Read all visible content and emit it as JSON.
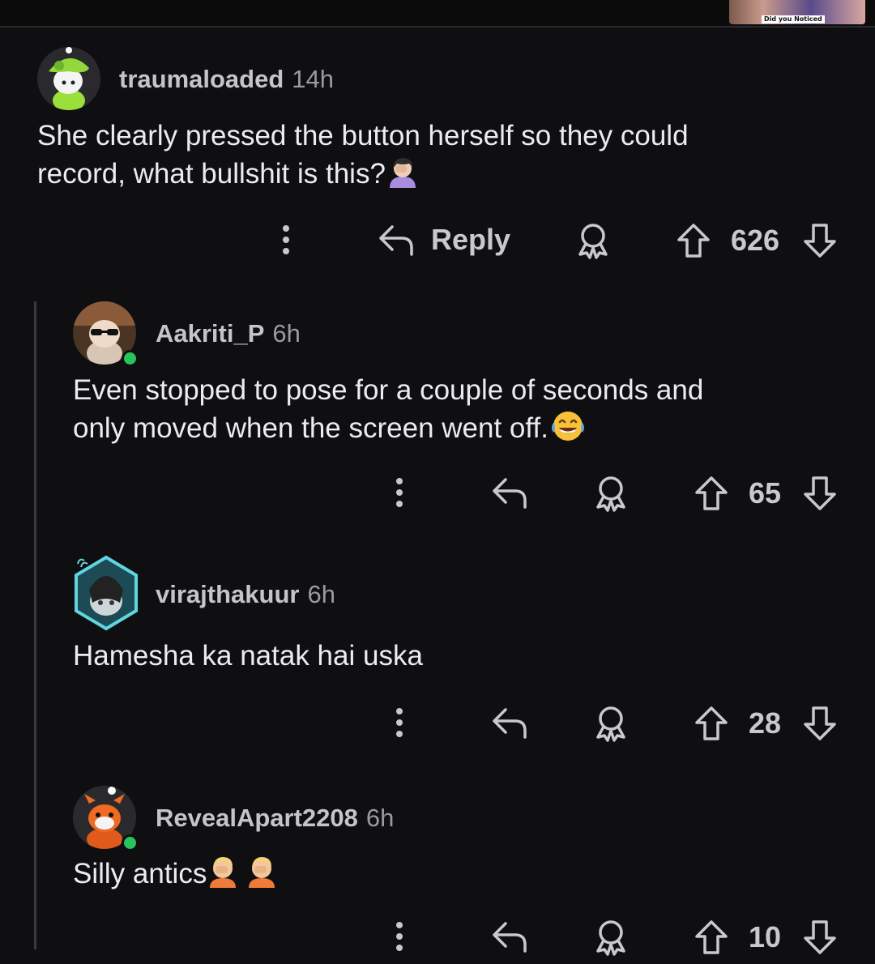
{
  "video_thumbnail": {
    "caption": "Did you Noticed"
  },
  "comments": [
    {
      "username": "traumaloaded",
      "age": "14h",
      "body": "She clearly pressed the button herself so they could",
      "body_line2": "record, what bullshit is this?",
      "emoji": "facepalm-woman-emoji",
      "reply_label": "Reply",
      "score": "626",
      "avatar": "green-hat-snoo-avatar",
      "online": false
    },
    {
      "username": "Aakriti_P",
      "age": "6h",
      "body": "Even stopped to pose for a couple of seconds and",
      "body_line2": "only moved when the screen went off.",
      "emoji": "tears-of-joy-emoji",
      "score": "65",
      "avatar": "sunglasses-snoo-avatar",
      "online": true
    },
    {
      "username": "virajthakuur",
      "age": "6h",
      "body": "Hamesha ka natak hai uska",
      "score": "28",
      "avatar": "hooded-snoo-nft-avatar",
      "online": false
    },
    {
      "username": "RevealApart2208",
      "age": "6h",
      "body": "Silly antics",
      "emoji": "facepalm-emoji",
      "score": "10",
      "avatar": "orange-snoo-avatar",
      "online": true
    }
  ],
  "colors": {
    "background": "#0f0f11",
    "online": "#29c35c",
    "thread_line": "#3a3b3f"
  }
}
